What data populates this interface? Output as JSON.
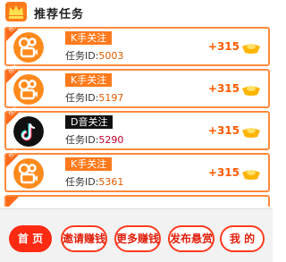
{
  "header": {
    "title": "推荐任务"
  },
  "tasks": [
    {
      "tag": "任务",
      "title": "K手关注",
      "id_label": "任务ID:",
      "id_value": "5003",
      "reward": "+315",
      "type": "kuaishou"
    },
    {
      "tag": "任务",
      "title": "K手关注",
      "id_label": "任务ID:",
      "id_value": "5197",
      "reward": "+315",
      "type": "kuaishou"
    },
    {
      "tag": "任务",
      "title": "D音关注",
      "id_label": "任务ID:",
      "id_value": "5290",
      "reward": "+315",
      "type": "douyin"
    },
    {
      "tag": "任务",
      "title": "K手关注",
      "id_label": "任务ID:",
      "id_value": "5361",
      "reward": "+315",
      "type": "kuaishou"
    }
  ],
  "footer": {
    "buttons": [
      {
        "label": "首 页",
        "active": true
      },
      {
        "label": "邀请赚钱",
        "active": false
      },
      {
        "label": "更多赚钱",
        "active": false
      },
      {
        "label": "发布悬赏",
        "active": false
      },
      {
        "label": "我 的",
        "active": false
      }
    ]
  },
  "colors": {
    "accent": "#ff6a1a",
    "reward": "#ff5a00",
    "border": "#ff8a3d",
    "nav_active": "#ff2a12"
  }
}
